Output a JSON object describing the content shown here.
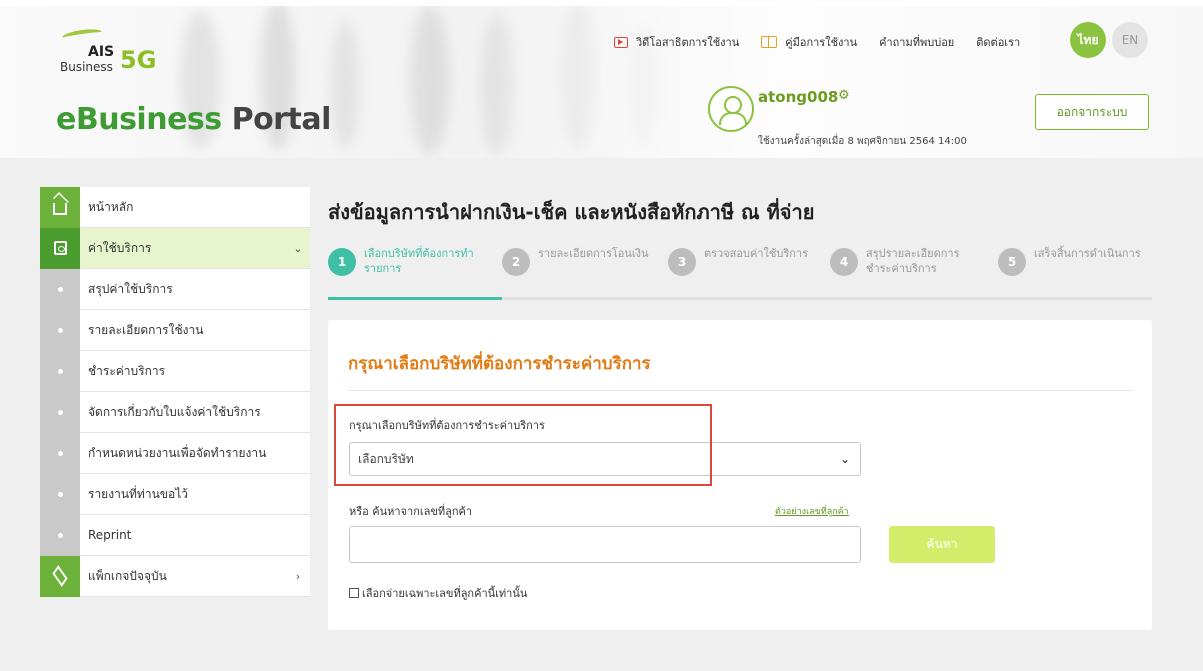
{
  "header": {
    "logo": {
      "ais": "AIS",
      "business": "Business",
      "fiveg": "5G",
      "portal_main": "eBusiness",
      "portal_sub": " Portal"
    },
    "links": [
      {
        "label": "วิดีโอสาธิตการใช้งาน",
        "icon": "video-icon"
      },
      {
        "label": "คู่มือการใช้งาน",
        "icon": "book-icon"
      },
      {
        "label": "คำถามที่พบบ่อย"
      },
      {
        "label": "ติดต่อเรา"
      }
    ],
    "lang": {
      "th": "ไทย",
      "en": "EN"
    },
    "user": {
      "name": "atong008",
      "last_login": "ใช้งานครั้งล่าสุดเมื่อ 8 พฤศจิกายน 2564 14:00"
    },
    "logout_label": "ออกจากระบบ"
  },
  "sidebar": {
    "items": [
      {
        "label": "หน้าหลัก"
      },
      {
        "label": "ค่าใช้บริการ",
        "arrow": "⌄"
      },
      {
        "label": "สรุปค่าใช้บริการ"
      },
      {
        "label": "รายละเอียดการใช้งาน"
      },
      {
        "label": "ชำระค่าบริการ"
      },
      {
        "label": "จัดการเกี่ยวกับใบแจ้งค่าใช้บริการ"
      },
      {
        "label": "กำหนดหน่วยงานเพื่อจัดทำรายงาน"
      },
      {
        "label": "รายงานที่ท่านขอไว้"
      },
      {
        "label": "Reprint"
      },
      {
        "label": "แพ็กเกจปัจจุบัน",
        "arrow": "›"
      }
    ]
  },
  "main": {
    "title": "ส่งข้อมูลการนำฝากเงิน-เช็ค และหนังสือหักภาษี ณ ที่จ่าย",
    "steps": [
      {
        "num": "1",
        "label": "เลือกบริษัทที่ต้องการทำรายการ"
      },
      {
        "num": "2",
        "label": "รายละเอียดการโอนเงิน"
      },
      {
        "num": "3",
        "label": "ตรวจสอบค่าใช้บริการ"
      },
      {
        "num": "4",
        "label": "สรุปรายละเอียดการชำระค่าบริการ"
      },
      {
        "num": "5",
        "label": "เสร็จสิ้นการดำเนินการ"
      }
    ],
    "card": {
      "title": "กรุณาเลือกบริษัทที่ต้องการชำระค่าบริการ",
      "select_label": "กรุณาเลือกบริษัทที่ต้องการชำระค่าบริการ",
      "select_value": "เลือกบริษัท",
      "or_label": "หรือ ค้นหาจากเลขที่ลูกค้า",
      "example_link": "ตัวอย่างเลขที่ลูกค้า",
      "search_value": "",
      "search_button": "ค้นหา",
      "checkbox_label": "เลือกจ่ายเฉพาะเลขที่ลูกค้านี้เท่านั้น"
    }
  },
  "colors": {
    "brand_green": "#6bb13a",
    "step_active": "#3fbfa5",
    "accent_orange": "#e27b14",
    "highlight_red": "#d9463a"
  }
}
